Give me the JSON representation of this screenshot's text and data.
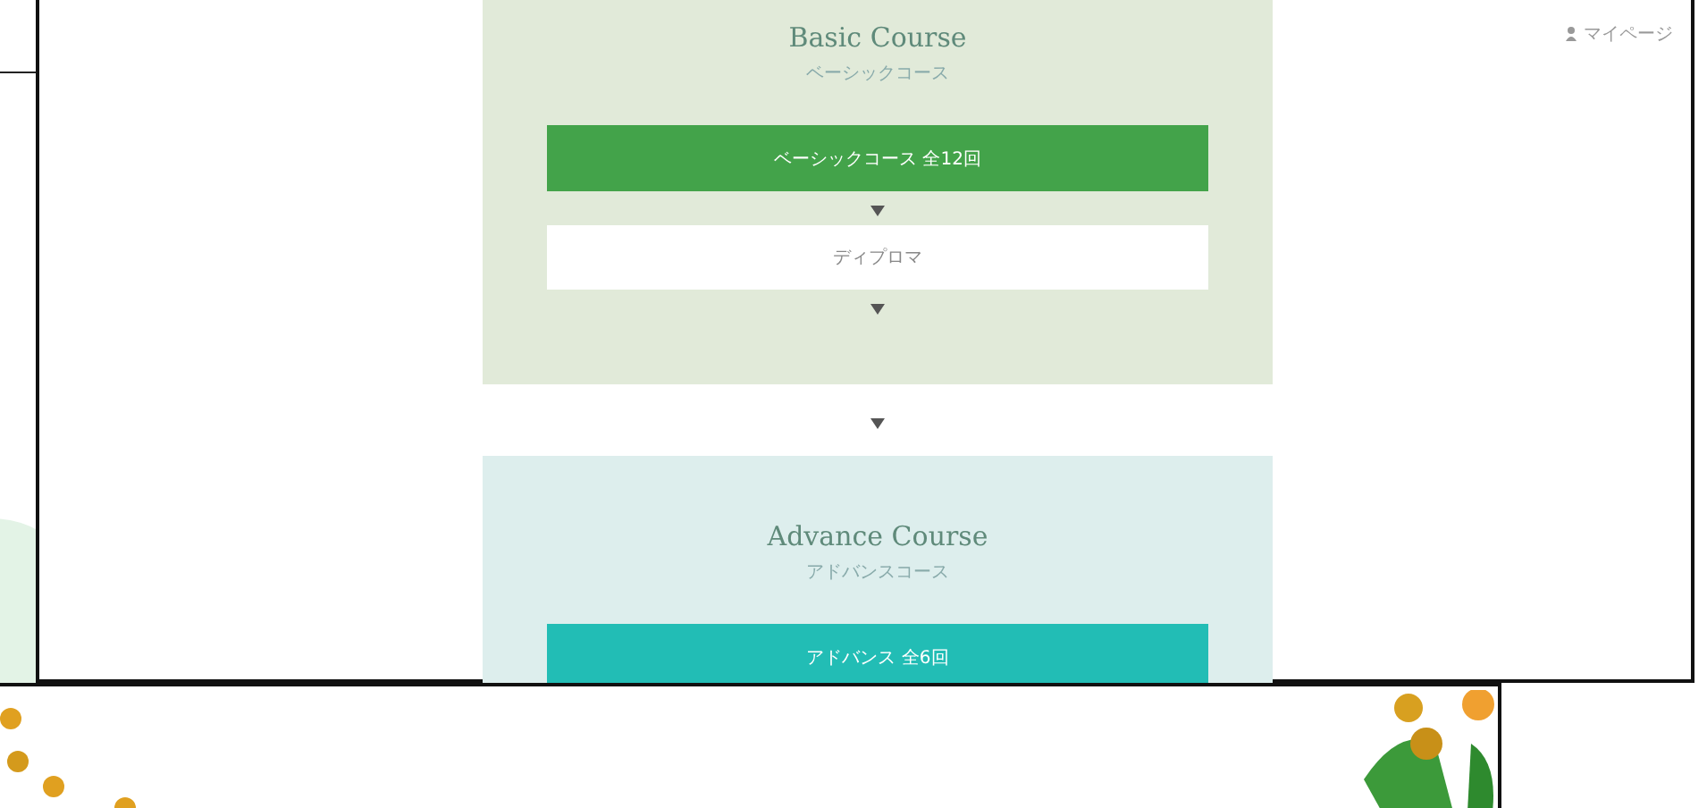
{
  "header": {
    "mypage_link": "マイページ"
  },
  "courses": [
    {
      "title": "Basic Course",
      "subtitle": "ベーシックコース",
      "kind": "basic",
      "steps": [
        {
          "label": "ベーシックコース 全12回",
          "kind": "filled"
        },
        {
          "label": "ディプロマ",
          "kind": "outline"
        }
      ]
    },
    {
      "title": "Advance Course",
      "subtitle": "アドバンスコース",
      "kind": "advance",
      "steps": [
        {
          "label": "アドバンス 全6回",
          "kind": "filled"
        }
      ]
    }
  ]
}
